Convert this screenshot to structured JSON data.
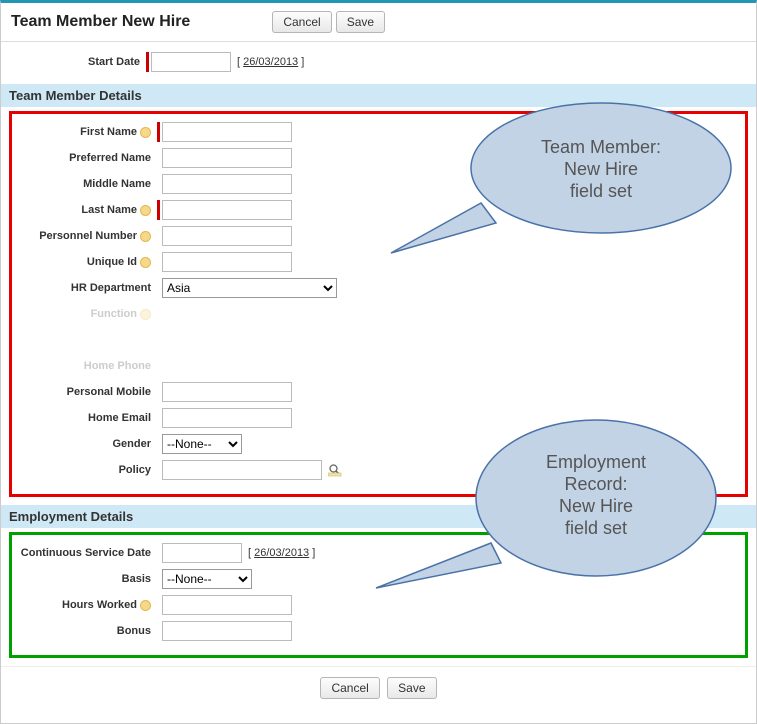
{
  "header": {
    "title": "Team Member New Hire",
    "cancel": "Cancel",
    "save": "Save"
  },
  "start": {
    "label": "Start Date",
    "value": "",
    "date_link": "26/03/2013"
  },
  "section1": {
    "title": "Team Member Details"
  },
  "tm": {
    "first_name_label": "First Name",
    "first_name_value": "",
    "preferred_name_label": "Preferred Name",
    "preferred_name_value": "",
    "middle_name_label": "Middle Name",
    "middle_name_value": "",
    "last_name_label": "Last Name",
    "last_name_value": "",
    "personnel_number_label": "Personnel Number",
    "personnel_number_value": "",
    "unique_id_label": "Unique Id",
    "unique_id_value": "",
    "hr_department_label": "HR Department",
    "hr_department_value": "Asia",
    "function_label": "Function",
    "home_phone_label": "Home Phone",
    "personal_mobile_label": "Personal Mobile",
    "personal_mobile_value": "",
    "home_email_label": "Home Email",
    "home_email_value": "",
    "gender_label": "Gender",
    "gender_value": "--None--",
    "policy_label": "Policy",
    "policy_value": ""
  },
  "section2": {
    "title": "Employment Details"
  },
  "emp": {
    "csd_label": "Continuous Service Date",
    "csd_value": "",
    "csd_date_link": "26/03/2013",
    "basis_label": "Basis",
    "basis_value": "--None--",
    "hours_worked_label": "Hours Worked",
    "hours_worked_value": "",
    "bonus_label": "Bonus",
    "bonus_value": ""
  },
  "footer": {
    "cancel": "Cancel",
    "save": "Save"
  },
  "callouts": {
    "top": {
      "line1": "Team Member:",
      "line2": "New Hire",
      "line3": "field set"
    },
    "bottom": {
      "line1": "Employment",
      "line2": "Record:",
      "line3": "New Hire",
      "line4": "field set"
    }
  }
}
